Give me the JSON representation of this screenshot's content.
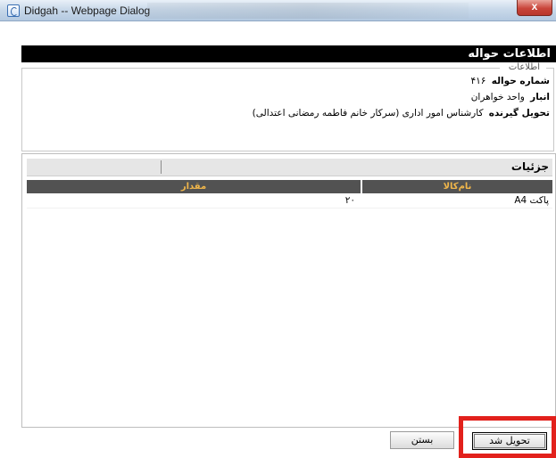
{
  "window": {
    "title": "Didgah -- Webpage Dialog",
    "close_glyph": "x",
    "icon": "ie-page-icon"
  },
  "header": {
    "title": "اطلاعات حواله"
  },
  "info": {
    "legend": "اطلاعات",
    "rows": [
      {
        "label": "شماره حواله",
        "value": "۴۱۶"
      },
      {
        "label": "انبار",
        "value": "واحد خواهران"
      },
      {
        "label": "تحویل گیرنده",
        "value": "کارشناس امور اداری (سرکار خانم فاطمه رمضانی اعتدالی)"
      }
    ]
  },
  "details": {
    "title": "جزئیات",
    "columns": {
      "item_name": "نام‌کالا",
      "quantity": "مقدار"
    },
    "rows": [
      {
        "item_name": "پاکت A4",
        "quantity": "۲۰"
      }
    ]
  },
  "buttons": {
    "close": "بستن",
    "delivered": "تحویل شد"
  },
  "colors": {
    "header_bg": "#000000",
    "grid_header_bg": "#525252",
    "grid_header_text": "#f0b64a",
    "highlight": "#e2211c"
  }
}
